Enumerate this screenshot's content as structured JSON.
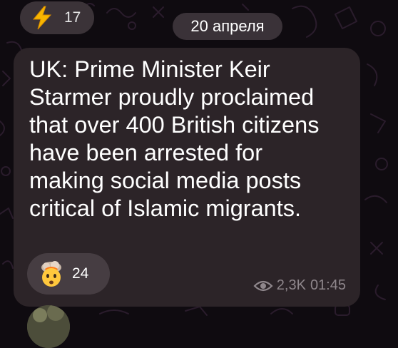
{
  "previous_message": {
    "reaction_icon": "lightning-icon",
    "reaction_count": "17"
  },
  "date_separator": "20 апреля",
  "message": {
    "text": "UK: Prime Minister Keir\nStarmer proudly proclaimed\nthat over 400 British citizens\nhave been arrested for\nmaking social media posts\ncritical of Islamic migrants.",
    "reaction": {
      "icon": "exploding-head-icon",
      "count": "24"
    },
    "views": "2,3K",
    "time": "01:45",
    "views_icon": "eye-icon"
  },
  "next_message": {
    "avatar_icon": "avatar"
  },
  "colors": {
    "background": "#0f0b10",
    "bubble": "#2c2428",
    "pill": "#3a3238",
    "meta_text": "#8f878c"
  }
}
